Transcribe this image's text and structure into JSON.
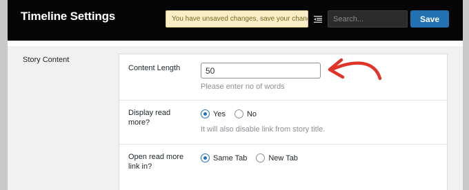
{
  "header": {
    "title": "Timeline Settings",
    "notice": "You have unsaved changes, save your changes!",
    "search_placeholder": "Search...",
    "save_label": "Save",
    "collapse_icon": "collapse-menu-icon"
  },
  "section": {
    "label": "Story Content"
  },
  "fields": {
    "content_length": {
      "label": "Content Length",
      "value": "50",
      "hint": "Please enter no of words"
    },
    "display_read_more": {
      "label": "Display read more?",
      "options": [
        "Yes",
        "No"
      ],
      "selected": "Yes",
      "hint": "It will also disable link from story title."
    },
    "open_read_more": {
      "label": "Open read more link in?",
      "options": [
        "Same Tab",
        "New Tab"
      ],
      "selected": "Same Tab"
    }
  },
  "colors": {
    "header_bg": "#050505",
    "accent": "#2271b1",
    "notice_bg": "#f9efc6",
    "annotation_arrow": "#e0342a"
  }
}
